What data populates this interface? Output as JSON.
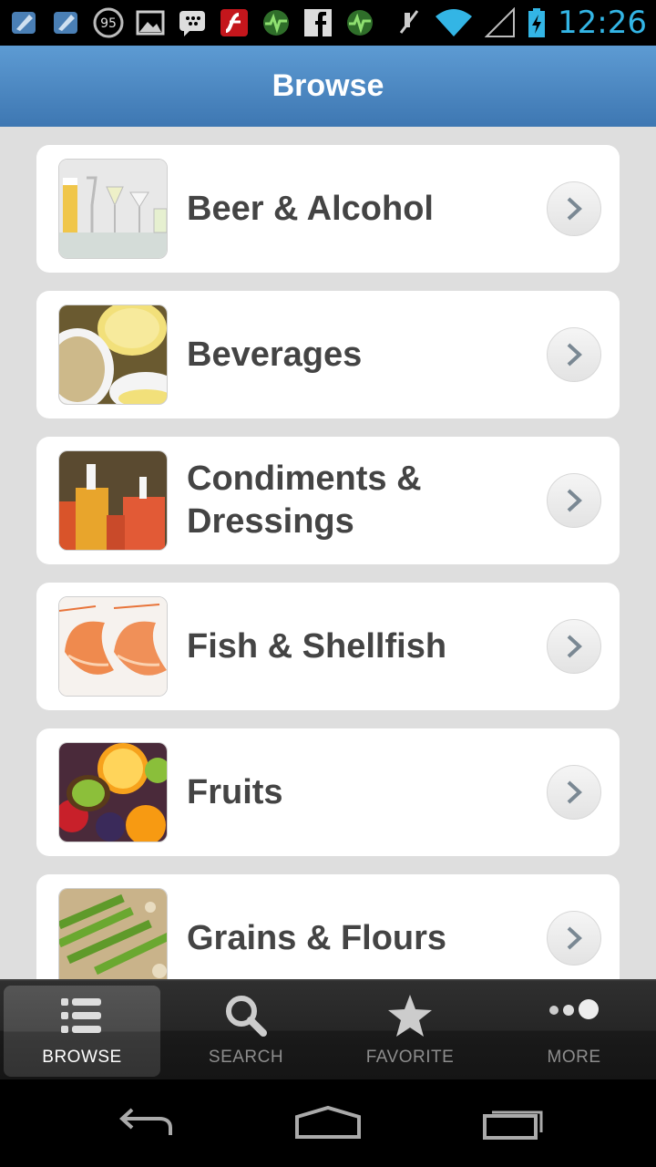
{
  "status_bar": {
    "time": "12:26",
    "badge_count": "95",
    "left_icons": [
      "app-icon",
      "app-icon",
      "count-badge-icon",
      "gallery-icon",
      "bbm-icon",
      "flash-icon",
      "activity-icon",
      "facebook-icon",
      "activity-icon"
    ],
    "right_icons": [
      "mute-icon",
      "wifi-icon",
      "signal-icon",
      "battery-charging-icon"
    ]
  },
  "header": {
    "title": "Browse"
  },
  "categories": [
    {
      "label": "Beer & Alcohol",
      "image": "glasses"
    },
    {
      "label": "Beverages",
      "image": "tea-lemon"
    },
    {
      "label": "Condiments & Dressings",
      "image": "condiment-bottles"
    },
    {
      "label": "Fish & Shellfish",
      "image": "shrimp"
    },
    {
      "label": "Fruits",
      "image": "fruits"
    },
    {
      "label": "Grains & Flours",
      "image": "grains"
    }
  ],
  "tabs": [
    {
      "label": "BROWSE",
      "icon": "list-icon",
      "active": true
    },
    {
      "label": "SEARCH",
      "icon": "search-icon",
      "active": false
    },
    {
      "label": "FAVORITE",
      "icon": "star-icon",
      "active": false
    },
    {
      "label": "MORE",
      "icon": "more-dots-icon",
      "active": false
    }
  ],
  "nav": [
    "back-icon",
    "home-icon",
    "recents-icon"
  ],
  "colors": {
    "header": "#4a86c2",
    "time": "#33b5e5",
    "row_text": "#444444"
  }
}
